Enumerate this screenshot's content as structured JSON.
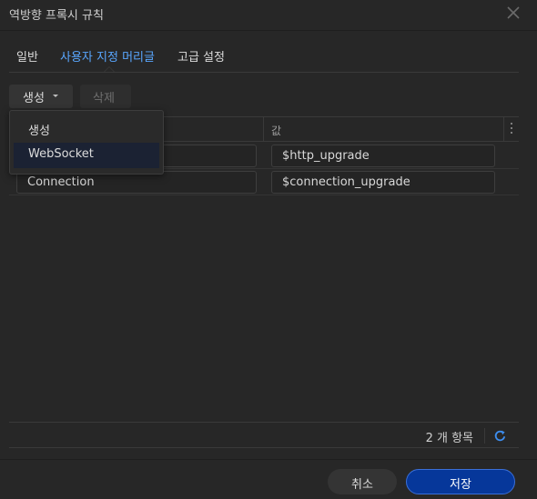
{
  "dialog": {
    "title": "역방향 프록시 규칙"
  },
  "tabs": [
    {
      "label": "일반",
      "active": false
    },
    {
      "label": "사용자 지정 머리글",
      "active": true
    },
    {
      "label": "고급 설정",
      "active": false
    }
  ],
  "toolbar": {
    "create_label": "생성",
    "delete_label": "삭제"
  },
  "create_menu": {
    "items": [
      {
        "label": "생성"
      },
      {
        "label": "WebSocket",
        "highlighted": true
      }
    ]
  },
  "grid": {
    "columns": [
      "",
      "값"
    ],
    "rows": [
      {
        "name": "",
        "value": "$http_upgrade"
      },
      {
        "name": "Connection",
        "value": "$connection_upgrade"
      }
    ],
    "footer": {
      "count_text": "2 개 항목"
    }
  },
  "buttons": {
    "cancel_label": "취소",
    "save_label": "저장"
  },
  "colors": {
    "accent": "#59a7ff",
    "primary_button": "#06379a",
    "background": "#272727"
  }
}
